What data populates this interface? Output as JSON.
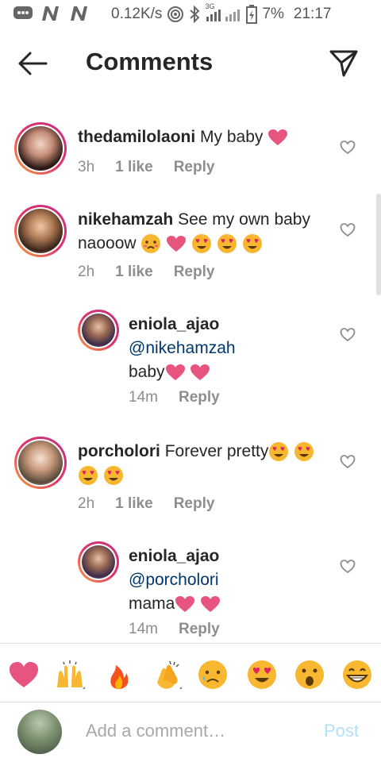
{
  "status_bar": {
    "speed": "0.12K/s",
    "battery": "7%",
    "time": "21:17",
    "network": "3G"
  },
  "header": {
    "title": "Comments",
    "back_icon": "arrow-left-icon",
    "send_icon": "paper-plane-icon"
  },
  "comments": [
    {
      "username": "thedamilolaoni",
      "text": "My baby",
      "time": "3h",
      "likes": "1 like",
      "reply": "Reply"
    },
    {
      "username": "nikehamzah",
      "text": "See my own baby naooow",
      "time": "2h",
      "likes": "1 like",
      "reply": "Reply"
    },
    {
      "username": "eniola_ajao",
      "mention": "@nikehamzah",
      "text": "baby",
      "time": "14m",
      "reply": "Reply"
    },
    {
      "username": "porcholori",
      "text": "Forever pretty",
      "time": "2h",
      "likes": "1 like",
      "reply": "Reply"
    },
    {
      "username": "eniola_ajao",
      "mention": "@porcholori",
      "text": "mama",
      "time": "14m",
      "reply": "Reply"
    }
  ],
  "emoji_bar": [
    "heart",
    "raised-hands",
    "fire",
    "clapping-hands",
    "crying-face",
    "heart-eyes",
    "surprised-face",
    "grinning-face"
  ],
  "composer": {
    "placeholder": "Add a comment…",
    "post_label": "Post"
  },
  "colors": {
    "post": "#b2dffc",
    "heart": "#e75480",
    "mention": "#00376b"
  }
}
